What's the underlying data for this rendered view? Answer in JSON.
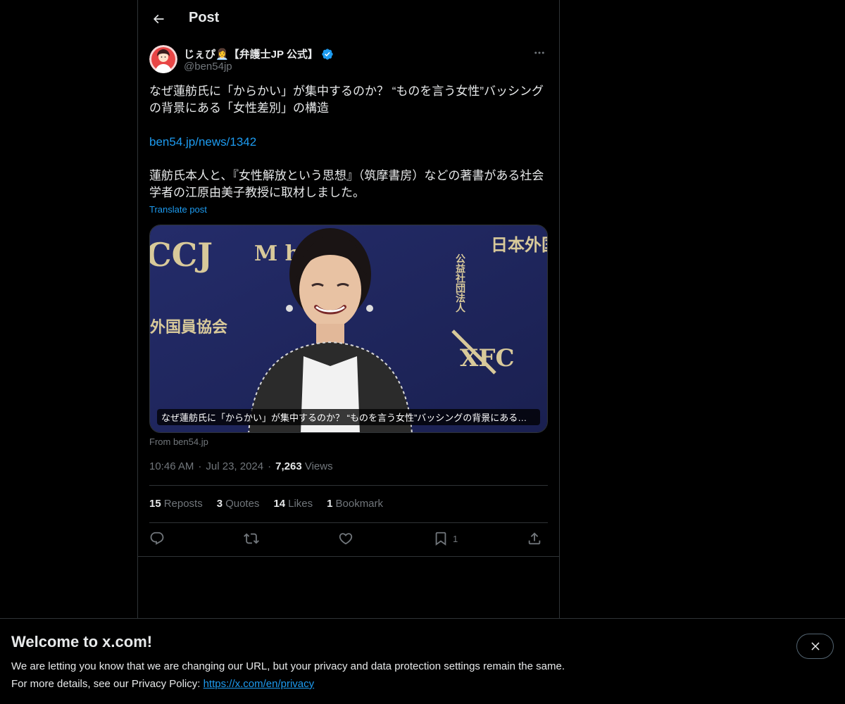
{
  "header": {
    "title": "Post",
    "back_icon": "arrow-left-icon"
  },
  "author": {
    "display_name": "じぇぴ👩‍💼【弁護士JP 公式】",
    "handle": "@ben54jp",
    "verified": true,
    "verified_color": "#1d9bf0"
  },
  "post": {
    "line1": "なぜ蓮舫氏に「からかい」が集中するのか？ “ものを言う女性”バッシングの背景にある「女性差別」の構造",
    "link": "ben54.jp/news/1342",
    "line3": "蓮舫氏本人と、『女性解放という思想』（筑摩書房）などの著書がある社会学者の江原由美子教授に取材しました。",
    "translate": "Translate post"
  },
  "card": {
    "caption": "なぜ蓮舫氏に「からかい」が集中するのか？ “ものを言う女性”バッシングの背景にある「女性差別」の構造",
    "source": "From ben54.jp",
    "photo_text_left": "CCJ",
    "photo_text_mid": "M    hi",
    "photo_text_right": "XFC",
    "photo_text_jp_right_small": "公益社団法人",
    "photo_text_jp_right": "日本外国特派員協会",
    "photo_text_jp_left": "外国員協会"
  },
  "meta": {
    "time": "10:46 AM",
    "date": "Jul 23, 2024",
    "views_count": "7,263",
    "views_label": "Views"
  },
  "stats": [
    {
      "num": "15",
      "label": "Reposts"
    },
    {
      "num": "3",
      "label": "Quotes"
    },
    {
      "num": "14",
      "label": "Likes"
    },
    {
      "num": "1",
      "label": "Bookmark"
    }
  ],
  "actions": {
    "bookmark_count": "1"
  },
  "banner": {
    "title": "Welcome to x.com!",
    "text1": "We are letting you know that we are changing our URL, but your privacy and data protection settings remain the same.",
    "text2_prefix": "For more details, see our Privacy Policy: ",
    "text2_link": "https://x.com/en/privacy"
  },
  "colors": {
    "accent": "#1d9bf0",
    "background": "#000000",
    "text": "#e7e9ea",
    "muted": "#71767b",
    "border": "#2f3336"
  }
}
